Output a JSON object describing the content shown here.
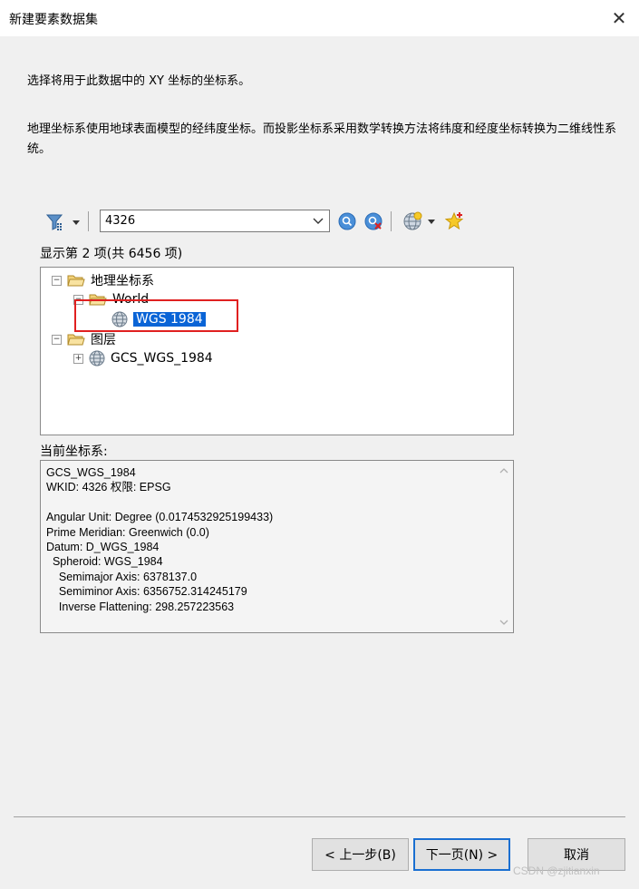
{
  "window": {
    "title": "新建要素数据集",
    "close_glyph": "✕"
  },
  "intro": {
    "line1": "选择将用于此数据中的 XY 坐标的坐标系。",
    "line2": "地理坐标系使用地球表面模型的经纬度坐标。而投影坐标系采用数学转换方法将纬度和经度坐标转换为二维线性系统。"
  },
  "toolbar": {
    "filter_icon": "filter-icon",
    "search_value": "4326",
    "search_icon": "search-icon",
    "clear_search_icon": "clear-search-icon",
    "globe_icon": "add-coordinate-system-icon",
    "favorite_icon": "add-to-favorites-icon"
  },
  "count_text": "显示第 2 项(共 6456 项)",
  "tree": {
    "nodes": [
      {
        "label": "地理坐标系",
        "expander": "⊟",
        "type": "folder"
      },
      {
        "label": "World",
        "expander": "⊟",
        "type": "folder"
      },
      {
        "label": "WGS 1984",
        "type": "globe",
        "selected": true
      },
      {
        "label": "图层",
        "expander": "⊟",
        "type": "folder"
      },
      {
        "label": "GCS_WGS_1984",
        "expander": "⊞",
        "type": "globe"
      }
    ]
  },
  "current": {
    "label": "当前坐标系:",
    "details": "GCS_WGS_1984\nWKID: 4326 权限: EPSG\n\nAngular Unit: Degree (0.0174532925199433)\nPrime Meridian: Greenwich (0.0)\nDatum: D_WGS_1984\n  Spheroid: WGS_1984\n    Semimajor Axis: 6378137.0\n    Semiminor Axis: 6356752.314245179\n    Inverse Flattening: 298.257223563"
  },
  "buttons": {
    "back": "< 上一步(B)",
    "next": "下一页(N) >",
    "cancel": "取消"
  },
  "watermark": "CSDN @zjitianxin",
  "colors": {
    "selection": "#0a64d6",
    "highlight_box": "#e02020",
    "primary_button_border": "#1a6fd1"
  }
}
